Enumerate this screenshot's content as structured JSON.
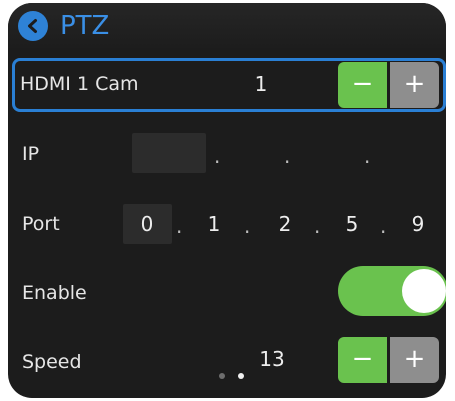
{
  "header": {
    "title": "PTZ"
  },
  "rows": {
    "camera": {
      "label": "HDMI 1 Cam",
      "value": "1",
      "minus": "−",
      "plus": "+"
    },
    "ip": {
      "label": "IP",
      "separators": [
        ".",
        ".",
        "."
      ]
    },
    "port": {
      "label": "Port",
      "digits": [
        "0",
        "1",
        "2",
        "5",
        "9"
      ],
      "separators": [
        ".",
        ".",
        ".",
        "."
      ]
    },
    "enable": {
      "label": "Enable",
      "on": true
    },
    "speed": {
      "label": "Speed",
      "value": "13",
      "minus": "−",
      "plus": "+"
    }
  },
  "colors": {
    "accent": "#2e82d6",
    "green": "#6ac24e",
    "gray_button": "#8e8e8e",
    "background": "#1c1c1c"
  },
  "icons": {
    "back": "chevron-left-icon"
  }
}
